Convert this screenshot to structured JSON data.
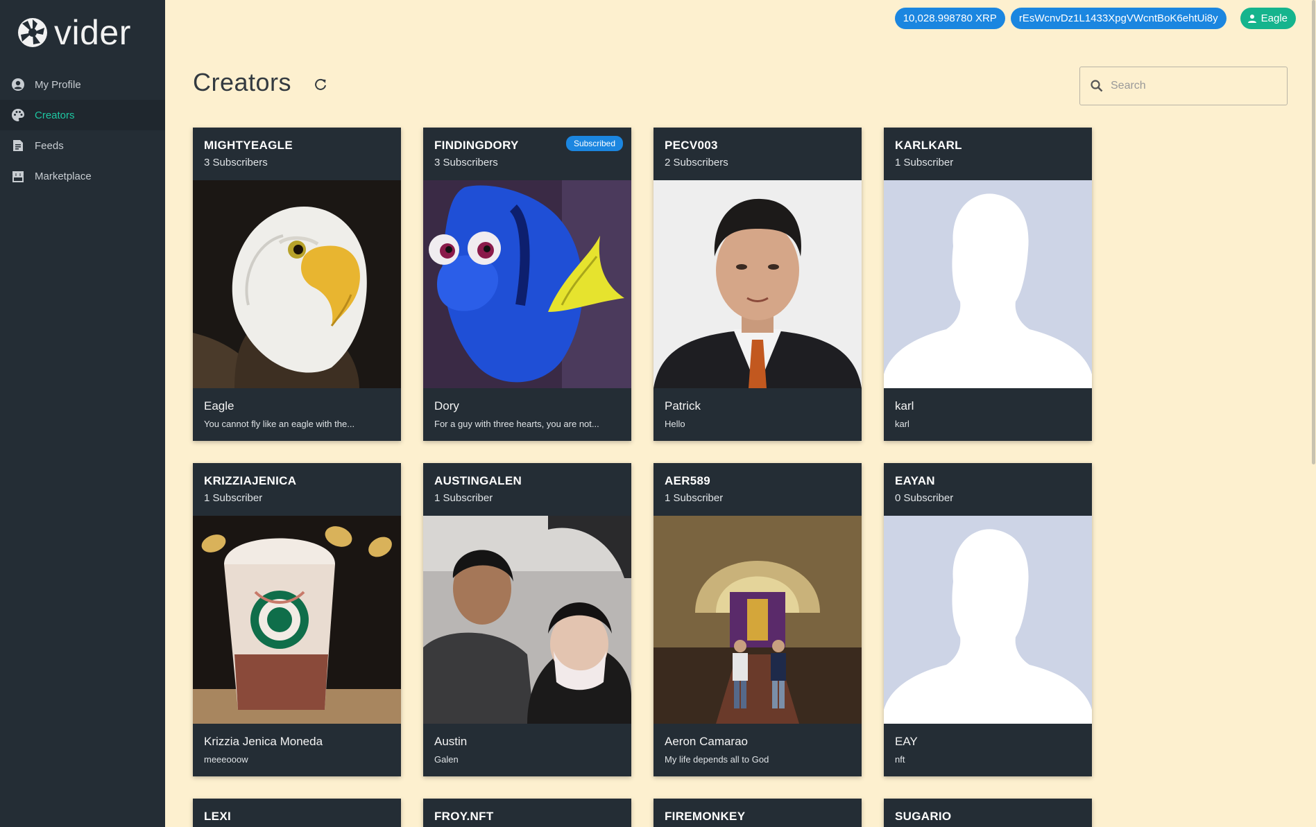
{
  "app": {
    "name": "vider"
  },
  "sidebar": {
    "items": [
      {
        "label": "My Profile",
        "icon": "account-circle-icon"
      },
      {
        "label": "Creators",
        "icon": "palette-icon",
        "active": true
      },
      {
        "label": "Feeds",
        "icon": "document-icon"
      },
      {
        "label": "Marketplace",
        "icon": "store-icon"
      }
    ]
  },
  "topbar": {
    "balance": "10,028.998780 XRP",
    "address": "rEsWcnvDz1L1433XpgVWcntBoK6ehtUi8y",
    "user": "Eagle"
  },
  "page": {
    "title": "Creators",
    "search_placeholder": "Search"
  },
  "creators": [
    {
      "username": "MIGHTYEAGLE",
      "subscribers": "3 Subscribers",
      "name": "Eagle",
      "bio": "You cannot fly like an eagle with the...",
      "subscribed": false,
      "image": "eagle-photo"
    },
    {
      "username": "FINDINGDORY",
      "subscribers": "3 Subscribers",
      "name": "Dory",
      "bio": "For a guy with three hearts, you are not...",
      "subscribed": true,
      "badge": "Subscribed",
      "image": "dory-fish-photo"
    },
    {
      "username": "PECV003",
      "subscribers": "2 Subscribers",
      "name": "Patrick",
      "bio": "Hello",
      "subscribed": false,
      "image": "man-portrait-photo"
    },
    {
      "username": "KARLKARL",
      "subscribers": "1 Subscriber",
      "name": "karl",
      "bio": "karl",
      "subscribed": false,
      "image": "default-avatar"
    },
    {
      "username": "KRIZZIAJENICA",
      "subscribers": "1 Subscriber",
      "name": "Krizzia Jenica Moneda",
      "bio": "meeeooow",
      "subscribed": false,
      "image": "coffee-cup-photo"
    },
    {
      "username": "AUSTINGALEN",
      "subscribers": "1 Subscriber",
      "name": "Austin",
      "bio": "Galen",
      "subscribed": false,
      "image": "couple-car-photo"
    },
    {
      "username": "AER589",
      "subscribers": "1 Subscriber",
      "name": "Aeron Camarao",
      "bio": "My life depends all to God",
      "subscribed": false,
      "image": "church-photo"
    },
    {
      "username": "EAYAN",
      "subscribers": "0 Subscriber",
      "name": "EAY",
      "bio": "nft",
      "subscribed": false,
      "image": "default-avatar"
    }
  ],
  "more_creators": [
    {
      "username": "LEXI"
    },
    {
      "username": "FROY.NFT"
    },
    {
      "username": "FIREMONKEY"
    },
    {
      "username": "SUGARIO"
    }
  ],
  "colors": {
    "background": "#fdf0cf",
    "sidebar": "#242d35",
    "accent": "#1ec7a2",
    "pill_blue": "#1b86e0",
    "pill_green": "#15b48d"
  }
}
